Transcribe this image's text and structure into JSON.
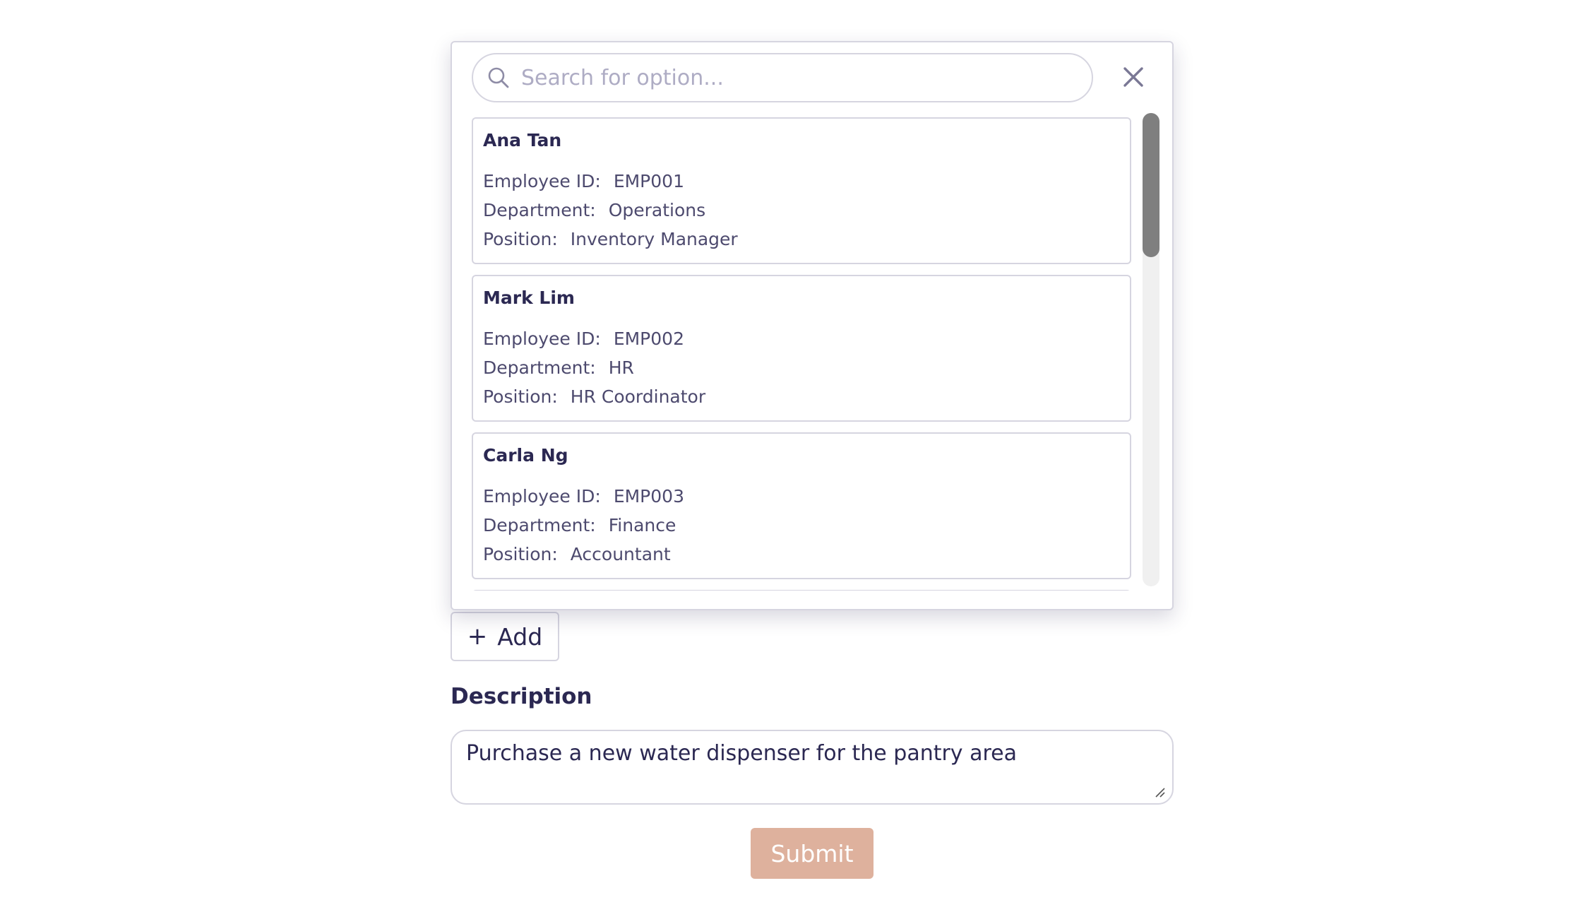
{
  "dropdown": {
    "search": {
      "placeholder": "Search for option...",
      "value": ""
    },
    "icons": {
      "search": "search-icon",
      "close": "close-icon"
    },
    "field_labels": {
      "employee_id": "Employee ID:",
      "department": "Department:",
      "position": "Position:"
    },
    "options": [
      {
        "name": "Ana Tan",
        "employee_id": "EMP001",
        "department": "Operations",
        "position": "Inventory Manager"
      },
      {
        "name": "Mark Lim",
        "employee_id": "EMP002",
        "department": "HR",
        "position": "HR Coordinator"
      },
      {
        "name": "Carla Ng",
        "employee_id": "EMP003",
        "department": "Finance",
        "position": "Accountant"
      }
    ]
  },
  "form": {
    "add_button": {
      "icon": "plus-icon",
      "label": "Add"
    },
    "description": {
      "label": "Description",
      "value": "Purchase a new water dispenser for the pantry area"
    },
    "submit_label": "Submit"
  },
  "colors": {
    "text_primary": "#2b2852",
    "border": "#d6d5e0",
    "submit_background": "#deb19d",
    "scrollbar_thumb": "#7f7f7f"
  }
}
